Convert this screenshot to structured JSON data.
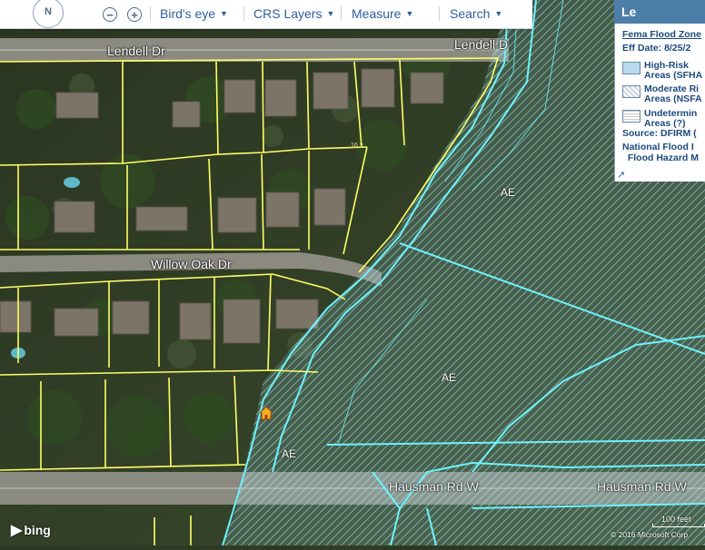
{
  "toolbar": {
    "compass_label": "N",
    "zoom_out_label": "−",
    "zoom_in_label": "+",
    "birds_eye": "Bird's eye",
    "crs_layers": "CRS Layers",
    "measure": "Measure",
    "search": "Search"
  },
  "layers_button": {
    "label": "Le"
  },
  "legend": {
    "title": "Fema Flood Zone",
    "eff_date": "Eff Date: 8/25/2",
    "items": [
      {
        "label1": "High-Risk",
        "label2": "Areas (SFHA"
      },
      {
        "label1": "Moderate Ri",
        "label2": "Areas (NSFA"
      },
      {
        "label1": "Undetermin",
        "label2": "Areas (?)"
      }
    ],
    "source": "Source: DFIRM (",
    "note1": "National Flood I",
    "note2": "  Flood Hazard M",
    "expand_icon": "↗"
  },
  "map": {
    "roads": {
      "lendell_left": "Lendell Dr",
      "lendell_right": "Lendell D",
      "willow_oak": "Willow Oak Dr",
      "hausman_left": "Hausman Rd W",
      "hausman_right": "Hausman Rd W"
    },
    "flood_zones": [
      "AE",
      "AE",
      "AE"
    ],
    "contour_labels": [
      "16.9",
      "AE",
      "AE"
    ],
    "colors": {
      "flood_line": "#6ff2ff",
      "parcel_line": "#ffff66",
      "flood_fill": "#b8eef7"
    }
  },
  "attribution": {
    "logo": "bing",
    "copyright": "© 2016 Microsoft Corp",
    "scale": "100 feet"
  }
}
